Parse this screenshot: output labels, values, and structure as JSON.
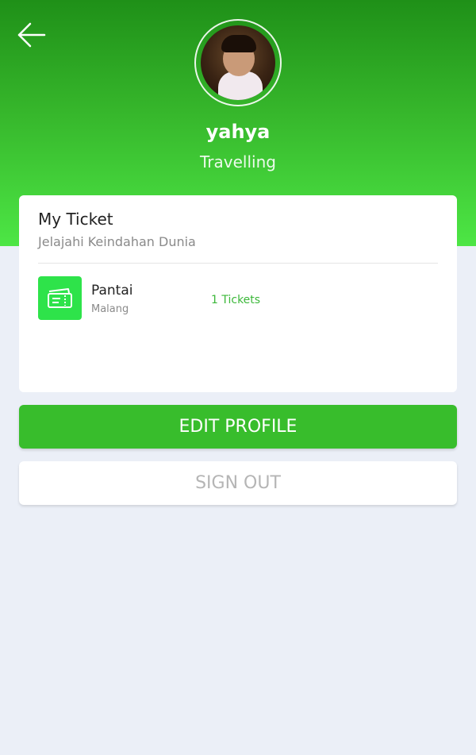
{
  "header": {
    "back_icon": "arrow-left-icon",
    "user_name": "yahya",
    "user_bio": "Travelling",
    "colors": {
      "top": "#1f9018",
      "bottom": "#4de645"
    }
  },
  "ticket_card": {
    "title": "My Ticket",
    "subtitle": "Jelajahi Keindahan Dunia",
    "items": [
      {
        "icon": "ticket-icon",
        "name": "Pantai",
        "location": "Malang",
        "count": "1 Tickets"
      }
    ]
  },
  "actions": {
    "edit_profile_label": "EDIT PROFILE",
    "sign_out_label": "SIGN OUT"
  },
  "colors": {
    "accent": "#38bd2c",
    "ticket_icon_bg": "#2ee34a",
    "page_bg": "#ebeff7"
  }
}
